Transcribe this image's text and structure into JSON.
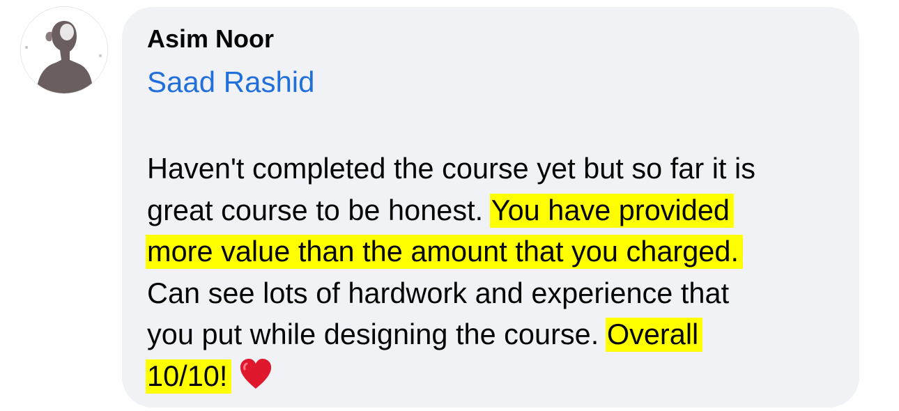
{
  "comment": {
    "author_name": "Asim Noor",
    "mention_name": "Saad Rashid",
    "body": {
      "line1": "Haven't completed the course yet but so far it is",
      "line2_plain": "great course to be honest.",
      "line2_highlight": "You have provided",
      "line3_highlight": "more value than the amount that you charged.",
      "line4": "Can see lots of hardwork and experience that",
      "line5_plain": "you put while designing the course.",
      "line5_highlight": "Overall",
      "line6_highlight": "10/10!"
    },
    "emoji": "heart-icon"
  },
  "colors": {
    "bubble_bg": "#f0f2f5",
    "mention": "#216fdb",
    "highlight": "#ffff00",
    "text": "#050505",
    "heart": "#e0182d"
  }
}
